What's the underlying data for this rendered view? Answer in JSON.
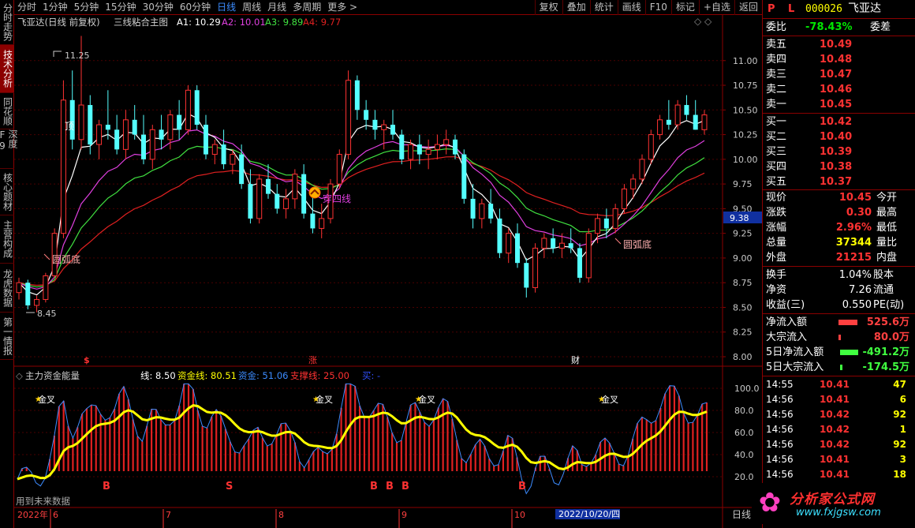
{
  "toolbar": {
    "periods": [
      "分时",
      "1分钟",
      "5分钟",
      "15分钟",
      "30分钟",
      "60分钟",
      "日线",
      "周线",
      "月线",
      "多周期",
      "更多 >"
    ],
    "active": "日线",
    "tools": [
      "复权",
      "叠加",
      "统计",
      "画线",
      "F10",
      "标记",
      "+自选",
      "返回"
    ]
  },
  "vtabs": [
    "分时走势",
    "技术分析",
    "同花顺",
    "深度F9",
    "核心题材",
    "主营构成",
    "龙虎数据",
    "第一情报"
  ],
  "vtab_active": "技术分析",
  "main_title": {
    "stock": "飞亚达(日线 前复权)",
    "indicator": "三线粘合主图",
    "a1": "A1: 10.29",
    "a2": "A2: 10.01",
    "a3": "A3: 9.89",
    "a4": "A4: 9.77"
  },
  "sub_title": {
    "name": "主力资金能量",
    "line": "线: 8.50",
    "fund_line": "资金线: 80.51",
    "fund": "资金: 51.06",
    "support": "支撑线: 25.00",
    "buy": "买: -"
  },
  "annotations": {
    "high": "11.25",
    "low": "8.45",
    "top": "顶",
    "rounded_bottom_1": "圆弧底",
    "rounded_bottom_2": "圆弧底",
    "through_four": "穿四线",
    "cursor_price": "9.38",
    "marker_zhang": "涨",
    "marker_cai": "财",
    "marker_dollar": "$",
    "golden_cross": "金叉",
    "b_label": "B",
    "s_label": "S",
    "future_data": "用到未来数据"
  },
  "axis": {
    "year": "2022年",
    "months": [
      "6",
      "7",
      "8",
      "9",
      "10"
    ],
    "cursor_date": "2022/10/20/四",
    "right_tab": "日线"
  },
  "colors": {
    "accent_red": "#ff3232",
    "accent_green": "#00e600",
    "price_yellow": "#ffff00",
    "a1_white": "#ffffff",
    "a2_magenta": "#e040e0",
    "a3_green": "#40e040",
    "a4_red": "#e02020",
    "down_candle": "#54ffff",
    "cursor_blue": "#1030a0"
  },
  "quote": {
    "code_label": "P L",
    "code": "000026",
    "name": "飞亚达",
    "wei_bi_label": "委比",
    "wei_bi": "-78.43%",
    "wei_cha_label": "委差",
    "asks": [
      {
        "label": "卖五",
        "price": "10.49"
      },
      {
        "label": "卖四",
        "price": "10.48"
      },
      {
        "label": "卖三",
        "price": "10.47"
      },
      {
        "label": "卖二",
        "price": "10.46"
      },
      {
        "label": "卖一",
        "price": "10.45"
      }
    ],
    "bids": [
      {
        "label": "买一",
        "price": "10.42"
      },
      {
        "label": "买二",
        "price": "10.40"
      },
      {
        "label": "买三",
        "price": "10.39"
      },
      {
        "label": "买四",
        "price": "10.38"
      },
      {
        "label": "买五",
        "price": "10.37"
      }
    ],
    "stats": [
      {
        "l": "现价",
        "v": "10.45",
        "r": "今开"
      },
      {
        "l": "涨跌",
        "v": "0.30",
        "r": "最高"
      },
      {
        "l": "涨幅",
        "v": "2.96%",
        "r": "最低"
      },
      {
        "l": "总量",
        "v": "37344",
        "r": "量比"
      },
      {
        "l": "外盘",
        "v": "21215",
        "r": "内盘"
      }
    ],
    "stats2": [
      {
        "l": "换手",
        "v": "1.04%",
        "r": "股本"
      },
      {
        "l": "净资",
        "v": "7.26",
        "r": "流通"
      },
      {
        "l": "收益(三)",
        "v": "0.550",
        "r": "PE(动)"
      }
    ],
    "flows": [
      {
        "label": "净流入额",
        "value": "525.6万",
        "bar": 0.8,
        "color": "#ff4040"
      },
      {
        "label": "大宗流入",
        "value": "80.0万",
        "bar": 0.06,
        "color": "#ff4040"
      },
      {
        "label": "5日净流入额",
        "value": "-491.2万",
        "bar": 0.75,
        "color": "#40ff40"
      },
      {
        "label": "5日大宗流入",
        "value": "-174.5万",
        "bar": 0.1,
        "color": "#40ff40"
      }
    ],
    "ticks": [
      {
        "time": "14:55",
        "price": "10.41",
        "vol": "47"
      },
      {
        "time": "14:56",
        "price": "10.41",
        "vol": "6"
      },
      {
        "time": "14:56",
        "price": "10.42",
        "vol": "92"
      },
      {
        "time": "14:56",
        "price": "10.42",
        "vol": "1"
      },
      {
        "time": "14:56",
        "price": "10.42",
        "vol": "92"
      },
      {
        "time": "14:56",
        "price": "10.41",
        "vol": "3"
      },
      {
        "time": "14:56",
        "price": "10.41",
        "vol": "18"
      }
    ]
  },
  "watermark": {
    "cn": "分析家公式网",
    "url": "www.fxjgsw.com"
  },
  "chart_data": {
    "type": "candlestick",
    "price_axis_ticks": [
      "11.00",
      "10.75",
      "10.50",
      "10.25",
      "10.00",
      "9.75",
      "9.50",
      "9.25",
      "9.00",
      "8.75",
      "8.50",
      "8.25",
      "8.00"
    ],
    "price_axis_range": [
      7.92,
      11.35
    ],
    "candles_ohlc": [
      [
        8.65,
        8.8,
        8.58,
        8.75
      ],
      [
        8.75,
        8.78,
        8.48,
        8.52
      ],
      [
        8.52,
        8.62,
        8.45,
        8.58
      ],
      [
        8.58,
        8.85,
        8.55,
        8.82
      ],
      [
        8.82,
        9.3,
        8.8,
        9.25
      ],
      [
        9.25,
        10.8,
        9.2,
        10.6
      ],
      [
        10.6,
        10.9,
        10.1,
        10.2
      ],
      [
        10.2,
        11.25,
        10.1,
        10.55
      ],
      [
        10.55,
        10.65,
        10.05,
        10.15
      ],
      [
        10.15,
        10.4,
        10.0,
        10.35
      ],
      [
        10.35,
        10.7,
        10.2,
        10.3
      ],
      [
        10.3,
        10.45,
        10.05,
        10.1
      ],
      [
        10.1,
        10.5,
        10.0,
        10.4
      ],
      [
        10.4,
        10.55,
        10.2,
        10.25
      ],
      [
        10.25,
        10.45,
        9.95,
        10.0
      ],
      [
        10.0,
        10.35,
        9.9,
        10.3
      ],
      [
        10.3,
        10.45,
        10.1,
        10.2
      ],
      [
        10.2,
        10.5,
        10.1,
        10.45
      ],
      [
        10.45,
        10.6,
        10.2,
        10.3
      ],
      [
        10.3,
        10.75,
        10.25,
        10.7
      ],
      [
        10.7,
        10.75,
        10.3,
        10.35
      ],
      [
        10.35,
        10.45,
        10.0,
        10.05
      ],
      [
        10.05,
        10.2,
        9.95,
        10.15
      ],
      [
        10.15,
        10.3,
        9.9,
        9.95
      ],
      [
        9.95,
        10.1,
        9.85,
        10.05
      ],
      [
        10.05,
        10.15,
        9.7,
        9.75
      ],
      [
        9.75,
        9.9,
        9.35,
        9.4
      ],
      [
        9.4,
        9.85,
        9.35,
        9.8
      ],
      [
        9.8,
        9.95,
        9.6,
        9.65
      ],
      [
        9.65,
        9.75,
        9.45,
        9.5
      ],
      [
        9.5,
        9.7,
        9.4,
        9.6
      ],
      [
        9.6,
        9.9,
        9.5,
        9.85
      ],
      [
        9.85,
        9.95,
        9.4,
        9.45
      ],
      [
        9.45,
        9.65,
        9.25,
        9.3
      ],
      [
        9.3,
        9.55,
        9.2,
        9.4
      ],
      [
        9.4,
        9.8,
        9.35,
        9.75
      ],
      [
        9.75,
        10.1,
        9.7,
        10.05
      ],
      [
        10.05,
        10.9,
        10.0,
        10.8
      ],
      [
        10.8,
        10.85,
        10.4,
        10.5
      ],
      [
        10.5,
        10.6,
        10.3,
        10.4
      ],
      [
        10.4,
        10.5,
        10.2,
        10.3
      ],
      [
        10.3,
        10.4,
        10.1,
        10.35
      ],
      [
        10.35,
        10.5,
        10.2,
        10.25
      ],
      [
        10.25,
        10.3,
        9.95,
        10.0
      ],
      [
        10.0,
        10.2,
        9.9,
        10.15
      ],
      [
        10.15,
        10.25,
        9.95,
        10.05
      ],
      [
        10.05,
        10.2,
        9.9,
        10.1
      ],
      [
        10.1,
        10.25,
        10.0,
        10.15
      ],
      [
        10.15,
        10.3,
        10.05,
        10.2
      ],
      [
        10.2,
        10.25,
        10.0,
        10.05
      ],
      [
        10.05,
        10.1,
        9.55,
        9.6
      ],
      [
        9.6,
        9.75,
        9.3,
        9.4
      ],
      [
        9.4,
        9.6,
        9.3,
        9.55
      ],
      [
        9.55,
        9.7,
        9.35,
        9.4
      ],
      [
        9.4,
        9.5,
        9.0,
        9.05
      ],
      [
        9.05,
        9.3,
        8.95,
        9.25
      ],
      [
        9.25,
        9.35,
        8.9,
        8.95
      ],
      [
        8.95,
        9.0,
        8.6,
        8.7
      ],
      [
        8.7,
        9.15,
        8.65,
        9.1
      ],
      [
        9.1,
        9.25,
        9.0,
        9.2
      ],
      [
        9.2,
        9.3,
        9.05,
        9.1
      ],
      [
        9.1,
        9.25,
        9.0,
        9.15
      ],
      [
        9.15,
        9.3,
        9.05,
        9.1
      ],
      [
        9.1,
        9.15,
        8.75,
        8.8
      ],
      [
        8.8,
        9.3,
        8.75,
        9.25
      ],
      [
        9.25,
        9.45,
        9.15,
        9.4
      ],
      [
        9.4,
        9.5,
        9.2,
        9.3
      ],
      [
        9.3,
        9.55,
        9.25,
        9.5
      ],
      [
        9.5,
        9.75,
        9.45,
        9.7
      ],
      [
        9.7,
        9.85,
        9.6,
        9.8
      ],
      [
        9.8,
        10.05,
        9.75,
        10.0
      ],
      [
        10.0,
        10.3,
        9.95,
        10.25
      ],
      [
        10.25,
        10.45,
        10.2,
        10.4
      ],
      [
        10.4,
        10.6,
        10.3,
        10.35
      ],
      [
        10.35,
        10.6,
        10.3,
        10.55
      ],
      [
        10.55,
        10.65,
        10.4,
        10.45
      ],
      [
        10.45,
        10.6,
        10.3,
        10.3
      ],
      [
        10.3,
        10.5,
        10.25,
        10.45
      ]
    ]
  }
}
